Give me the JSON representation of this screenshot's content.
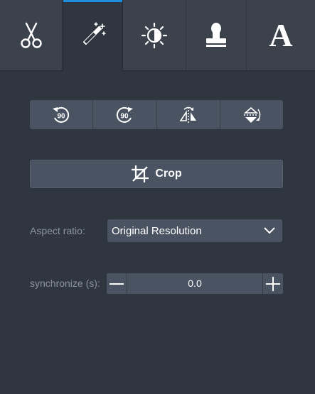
{
  "tabs": [
    {
      "id": "cut",
      "icon": "scissors-icon",
      "active": false
    },
    {
      "id": "effects",
      "icon": "magic-wand-icon",
      "active": true
    },
    {
      "id": "adjust",
      "icon": "brightness-icon",
      "active": false
    },
    {
      "id": "stamp",
      "icon": "stamp-icon",
      "active": false
    },
    {
      "id": "text",
      "icon": "text-icon",
      "glyph": "A",
      "active": false
    }
  ],
  "rotate_buttons": [
    {
      "icon": "rotate-left-90-icon",
      "label": "90"
    },
    {
      "icon": "rotate-right-90-icon",
      "label": "90"
    },
    {
      "icon": "flip-horizontal-icon"
    },
    {
      "icon": "flip-vertical-icon"
    }
  ],
  "crop": {
    "label": "Crop",
    "icon": "crop-icon"
  },
  "aspect": {
    "label": "Aspect ratio:",
    "value": "Original Resolution",
    "icon": "chevron-down-icon"
  },
  "sync": {
    "label": "synchronize (s):",
    "value": "0.0",
    "minus_icon": "minus-icon",
    "plus_icon": "plus-icon"
  },
  "colors": {
    "accent": "#1e8fe0",
    "panel": "#2f363f",
    "tabbar": "#3b424c",
    "control": "#4a5361"
  }
}
